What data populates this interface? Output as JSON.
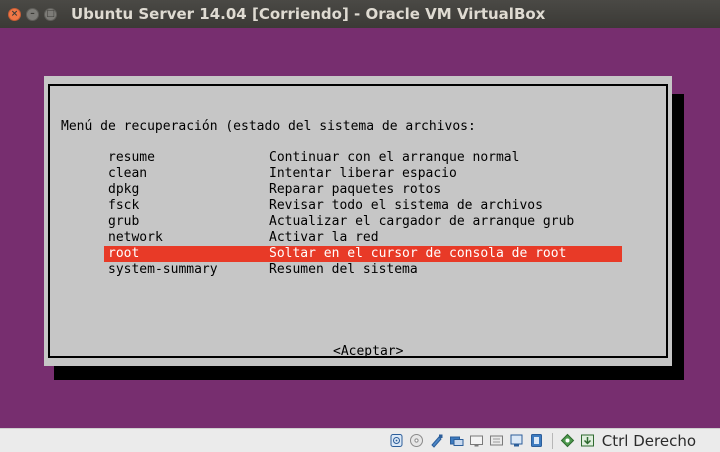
{
  "window": {
    "title": "Ubuntu Server 14.04 [Corriendo] - Oracle VM VirtualBox",
    "buttons": {
      "close": "×",
      "minimize": "–",
      "maximize": "□"
    }
  },
  "console": {
    "background_color": "#772e6f",
    "dialog": {
      "title": "Menú de recuperación (estado del sistema de archivos:",
      "options": [
        {
          "key": "resume",
          "description": "Continuar con el arranque normal"
        },
        {
          "key": "clean",
          "description": "Intentar liberar espacio"
        },
        {
          "key": "dpkg",
          "description": "Reparar paquetes rotos"
        },
        {
          "key": "fsck",
          "description": "Revisar todo el sistema de archivos"
        },
        {
          "key": "grub",
          "description": "Actualizar el cargador de arranque grub"
        },
        {
          "key": "network",
          "description": "Activar la red"
        },
        {
          "key": "root",
          "description": "Soltar en el cursor de consola de root"
        },
        {
          "key": "system-summary",
          "description": "Resumen del sistema"
        }
      ],
      "selected_key": "root",
      "accept_button": "<Aceptar>",
      "highlight_color": "#e83a27"
    }
  },
  "statusbar": {
    "icons": [
      "hard-disk-icon",
      "optical-drive-icon",
      "usb-icon",
      "shared-folders-icon",
      "display-icon",
      "video-capture-icon",
      "network-icon",
      "cpu-icon",
      "mouse-integration-icon",
      "keyboard-icon"
    ],
    "host_key": "Ctrl Derecho"
  }
}
